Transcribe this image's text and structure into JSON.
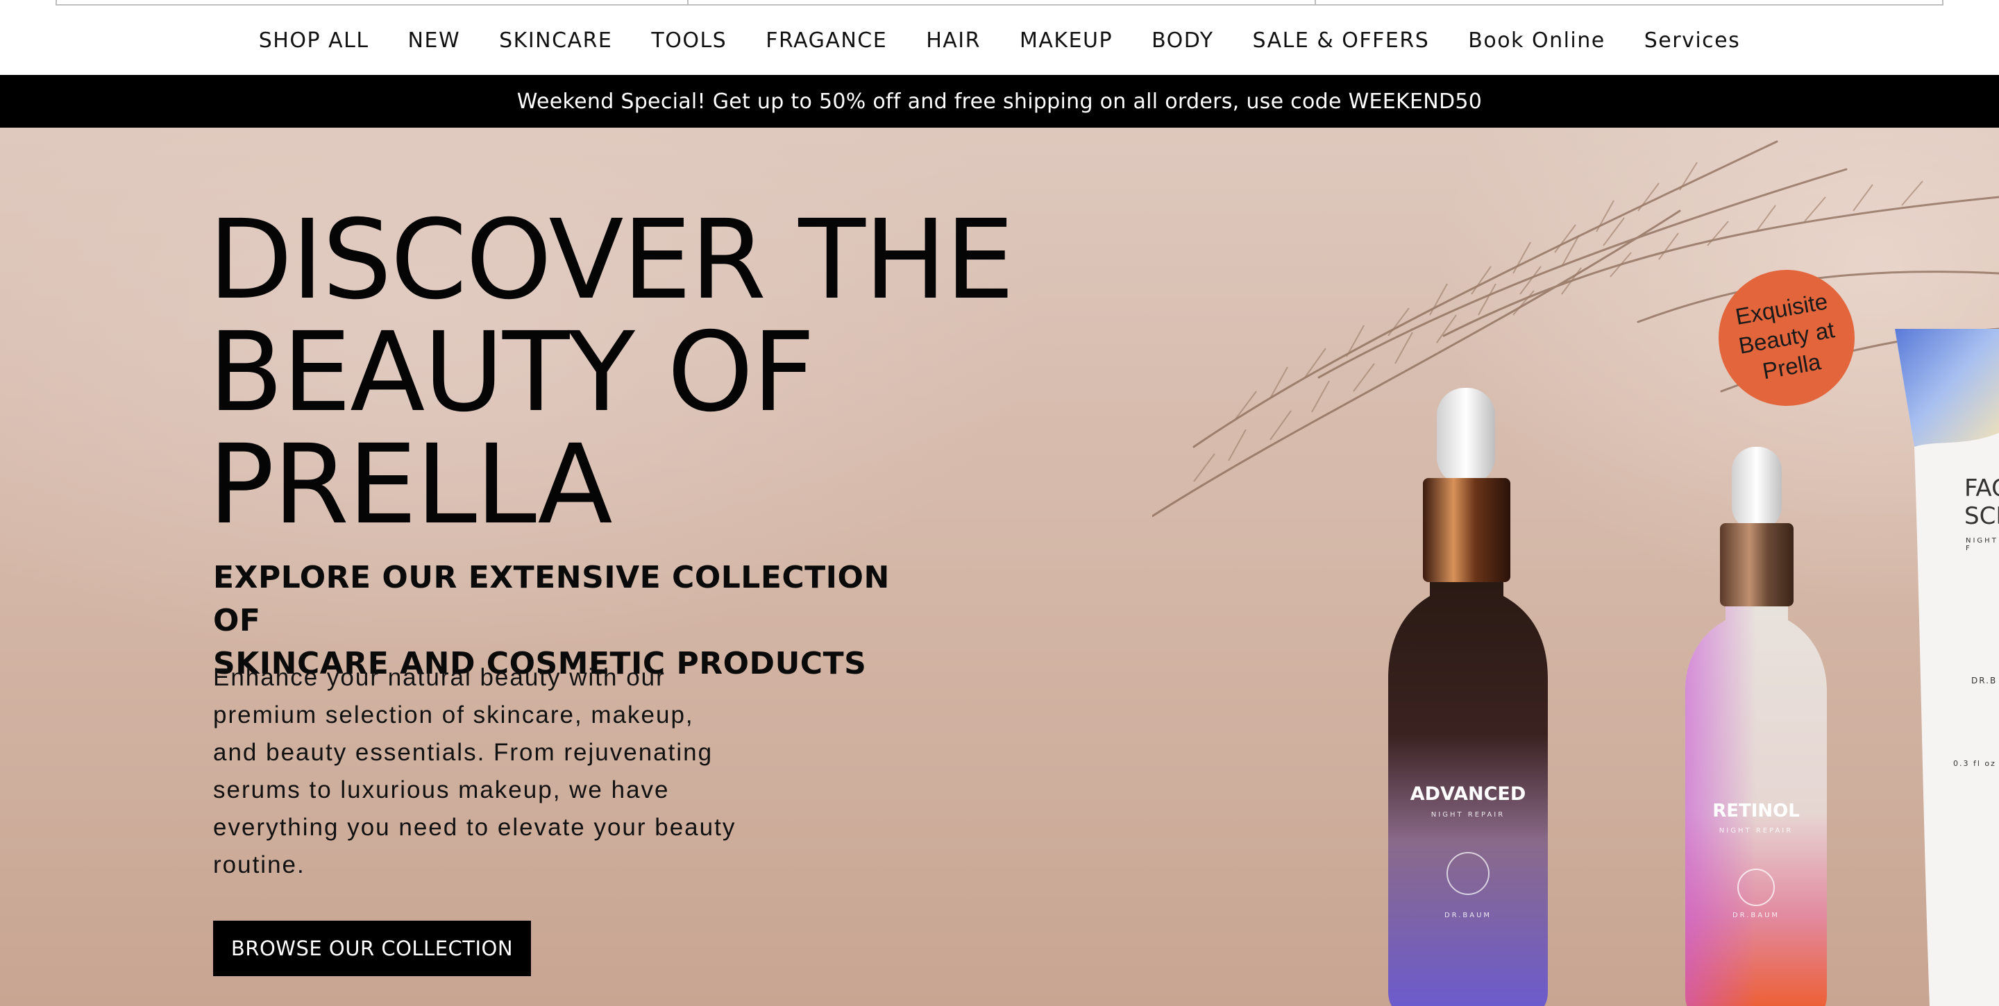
{
  "nav": {
    "items": [
      {
        "label": "SHOP ALL"
      },
      {
        "label": "NEW"
      },
      {
        "label": "SKINCARE"
      },
      {
        "label": "TOOLS"
      },
      {
        "label": "FRAGANCE"
      },
      {
        "label": "HAIR"
      },
      {
        "label": "MAKEUP"
      },
      {
        "label": "BODY"
      },
      {
        "label": "SALE & OFFERS"
      },
      {
        "label": "Book Online"
      },
      {
        "label": "Services"
      }
    ]
  },
  "announcement": {
    "text": "Weekend Special! Get up to 50% off and free shipping on all orders, use code WEEKEND50"
  },
  "hero": {
    "headline_lines": [
      "DISCOVER THE",
      "BEAUTY OF",
      "PRELLA"
    ],
    "subheadline_lines": [
      "EXPLORE OUR EXTENSIVE COLLECTION OF",
      "SKINCARE AND COSMETIC PRODUCTS"
    ],
    "body_lines": [
      "Enhance your natural beauty with our",
      "premium selection of skincare, makeup,",
      "and beauty essentials. From rejuvenating",
      "serums to luxurious makeup, we have",
      "everything you need to elevate your beauty",
      "routine."
    ],
    "cta_label": "BROWSE OUR COLLECTION",
    "badge_lines": [
      "Exquisite",
      "Beauty at",
      "Prella"
    ]
  },
  "products": {
    "bottle1": {
      "name": "ADVANCED",
      "subtitle": "NIGHT REPAIR",
      "brand": "DR.BAUM"
    },
    "bottle2": {
      "name": "RETINOL",
      "subtitle": "NIGHT REPAIR",
      "brand": "DR.BAUM"
    },
    "tube": {
      "name_lines": [
        "FAC",
        "SCF"
      ],
      "subtitle": "NIGHT F",
      "brand": "DR.B",
      "size": "0.3 fl oz"
    }
  },
  "colors": {
    "announcement_bg": "#000000",
    "badge": "#e2653c",
    "cta_bg": "#000000",
    "hero_bg": "#d8bcae"
  }
}
